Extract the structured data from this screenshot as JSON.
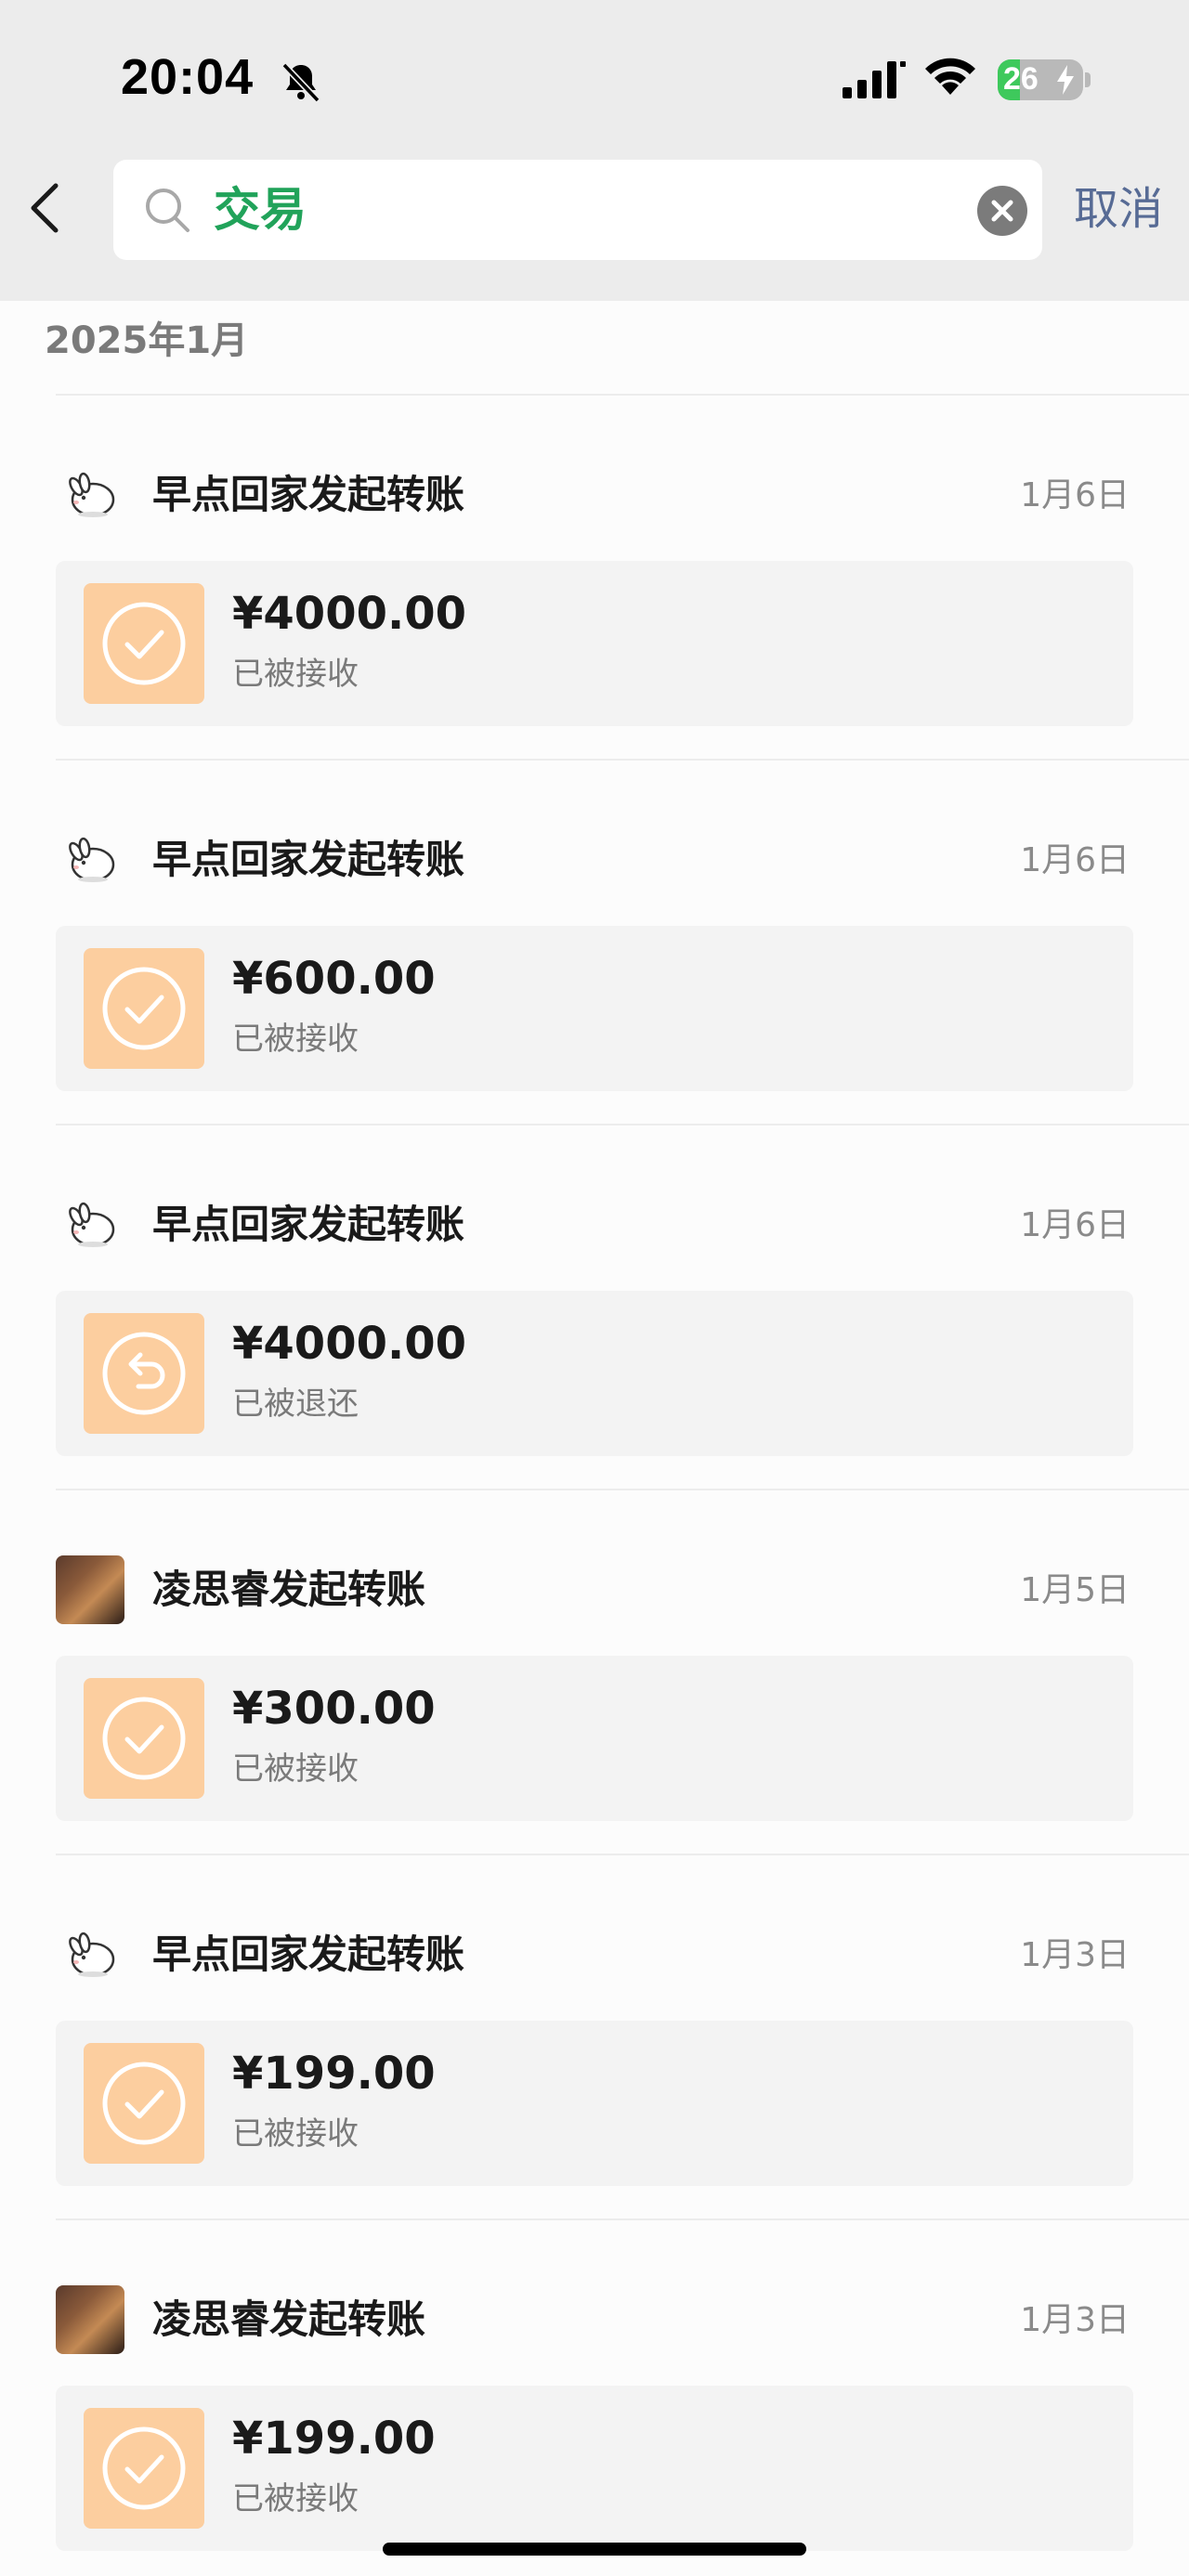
{
  "status_bar": {
    "time": "20:04",
    "battery_level": "26",
    "battery_fraction": 0.26,
    "icons": [
      "bell-off-icon",
      "signal-icon",
      "wifi-icon",
      "battery-icon"
    ]
  },
  "search": {
    "query": "交易",
    "cancel_label": "取消",
    "icons": [
      "back-chevron-icon",
      "search-icon",
      "clear-icon"
    ]
  },
  "month_header": "2025年1月",
  "colors": {
    "accent_green": "#21a35a",
    "cancel_blue": "#576b95",
    "transfer_orange": "#fcce9f"
  },
  "transactions": [
    {
      "title": "早点回家发起转账",
      "date": "1月6日",
      "amount": "¥4000.00",
      "status": "已被接收",
      "avatar": "rabbit",
      "status_icon": "check-circle-icon"
    },
    {
      "title": "早点回家发起转账",
      "date": "1月6日",
      "amount": "¥600.00",
      "status": "已被接收",
      "avatar": "rabbit",
      "status_icon": "check-circle-icon"
    },
    {
      "title": "早点回家发起转账",
      "date": "1月6日",
      "amount": "¥4000.00",
      "status": "已被退还",
      "avatar": "rabbit",
      "status_icon": "return-circle-icon"
    },
    {
      "title": "凌思睿发起转账",
      "date": "1月5日",
      "amount": "¥300.00",
      "status": "已被接收",
      "avatar": "photo",
      "status_icon": "check-circle-icon"
    },
    {
      "title": "早点回家发起转账",
      "date": "1月3日",
      "amount": "¥199.00",
      "status": "已被接收",
      "avatar": "rabbit",
      "status_icon": "check-circle-icon"
    },
    {
      "title": "凌思睿发起转账",
      "date": "1月3日",
      "amount": "¥199.00",
      "status": "已被接收",
      "avatar": "photo",
      "status_icon": "check-circle-icon"
    }
  ]
}
